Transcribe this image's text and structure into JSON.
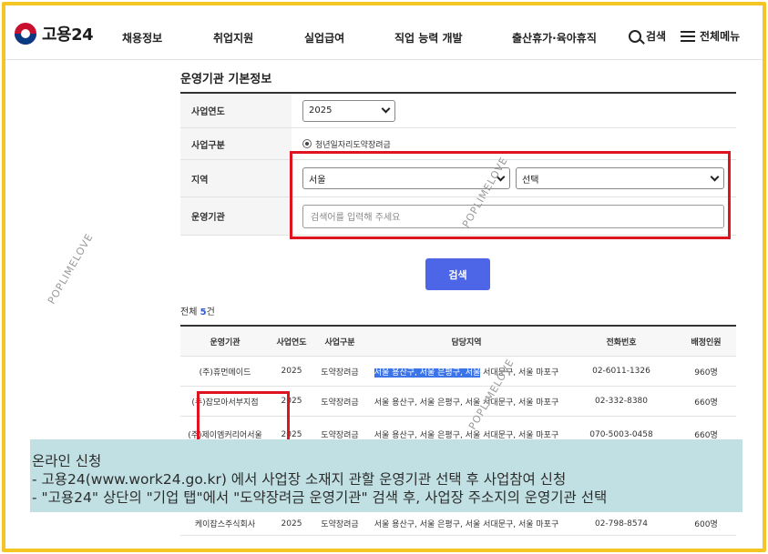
{
  "header": {
    "logo_text": "고용24",
    "nav": [
      "채용정보",
      "취업지원",
      "실업급여",
      "직업 능력 개발",
      "출산휴가·육아휴직"
    ],
    "search_label": "검색",
    "menu_label": "전체메뉴"
  },
  "form": {
    "title": "운영기관 기본정보",
    "year_label": "사업연도",
    "year_value": "2025",
    "type_label": "사업구분",
    "type_value": "청년일자리도약장려금",
    "region_label": "지역",
    "region_value": "서울",
    "district_value": "선택",
    "org_label": "운영기관",
    "org_placeholder": "검색어를 입력해 주세요",
    "search_button": "검색"
  },
  "results": {
    "total_prefix": "전체 ",
    "total_count": "5",
    "total_suffix": "건",
    "columns": [
      "운영기관",
      "사업연도",
      "사업구분",
      "담당지역",
      "전화번호",
      "배정인원"
    ],
    "rows": [
      {
        "org": "(주)휴먼메이드",
        "year": "2025",
        "type": "도약장려금",
        "region_hl": "서울 용산구, 서울 은평구, 서울",
        "region_rest": " 서대문구, 서울 마포구",
        "phone": "02-6011-1326",
        "count": "960명"
      },
      {
        "org": "(주)잡모아서부지점",
        "year": "2025",
        "type": "도약장려금",
        "region_hl": "",
        "region_rest": "서울 용산구, 서울 은평구, 서울 서대문구, 서울 마포구",
        "phone": "02-332-8380",
        "count": "660명"
      },
      {
        "org": "(주)제이엠커리어서울",
        "year": "2025",
        "type": "도약장려금",
        "region_hl": "",
        "region_rest": "서울 용산구, 서울 은평구, 서울 서대문구, 서울 마포구",
        "phone": "070-5003-0458",
        "count": "660명"
      }
    ],
    "last_row": {
      "org": "케이잡스주식회사",
      "year": "2025",
      "type": "도약장려금",
      "region": "서울 용산구, 서울 은평구, 서울 서대문구, 서울 마포구",
      "phone": "02-798-8574",
      "count": "600명"
    }
  },
  "overlay": {
    "line1": "온라인 신청",
    "line2": " - 고용24(www.work24.go.kr) 에서 사업장 소재지 관할 운영기관 선택 후  사업참여 신청",
    "line3": " - \"고용24\" 상단의 \"기업 탭\"에서 \"도약장려금 운영기관\" 검색 후, 사업장 주소지의 운영기관 선택"
  },
  "watermark": "POPLIMELOVE",
  "colors": {
    "frame": "#f3c623",
    "highlight_box": "#e0141e",
    "button": "#4d66e8",
    "overlay": "#c1e0e3"
  }
}
